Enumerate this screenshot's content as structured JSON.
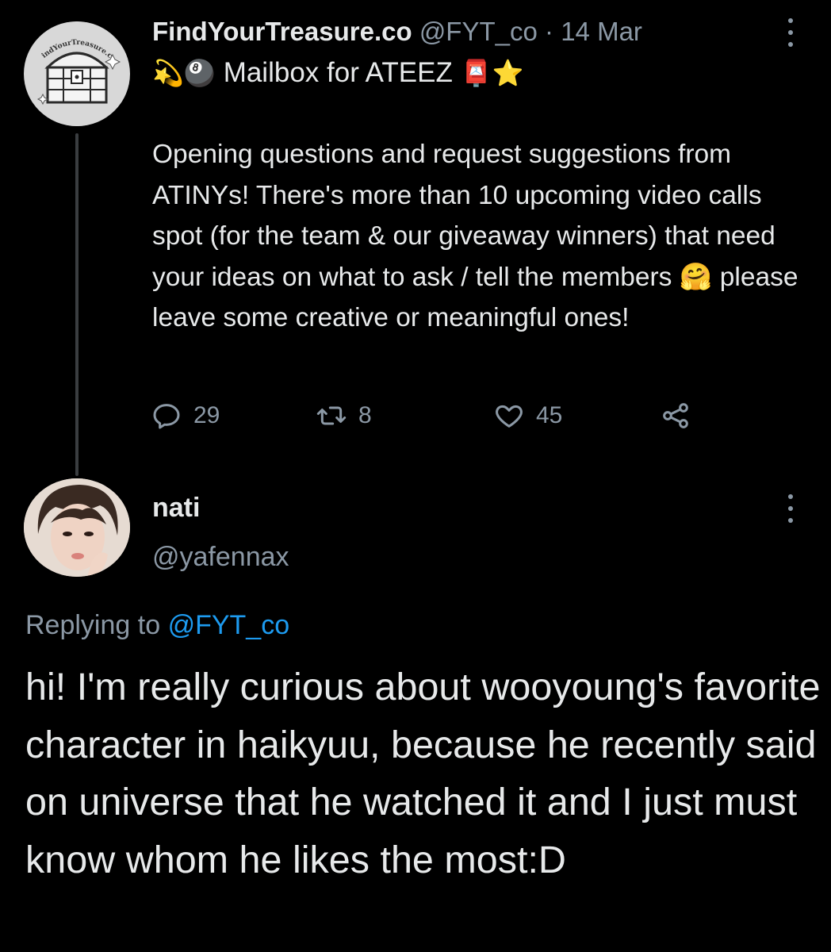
{
  "parent_tweet": {
    "display_name": "FindYourTreasure.co",
    "handle": "@FYT_co",
    "separator": "·",
    "date": "14 Mar",
    "bio": {
      "emoji_prefix": "💫🎱",
      "text": "Mailbox for ATEEZ",
      "emoji_suffix": "📮⭐"
    },
    "avatar_logo_text": "FindYourTreasure.co",
    "text": "Opening questions and request suggestions from ATINYs! There's more than 10 upcoming video calls spot (for the team & our giveaway winners) that need your ideas on what to ask / tell the members 🤗 please leave some creative or meaningful ones!",
    "actions": {
      "replies": "29",
      "retweets": "8",
      "likes": "45"
    }
  },
  "reply_tweet": {
    "display_name": "nati",
    "handle": "@yafennax",
    "replying_to_label": "Replying to",
    "replying_to_handle": "@FYT_co",
    "text": "hi! I'm really curious about wooyoung's favorite character in haikyuu, because he recently said on universe that he watched it and I just must know whom he likes the most:D"
  },
  "icons": {
    "reply": "reply-icon",
    "retweet": "retweet-icon",
    "like": "heart-icon",
    "share": "share-icon",
    "more": "more-icon"
  },
  "colors": {
    "background": "#000000",
    "text": "#e7e9ea",
    "muted": "#8b98a5",
    "link": "#1d9bf0",
    "thread_line": "#3a3d40"
  }
}
